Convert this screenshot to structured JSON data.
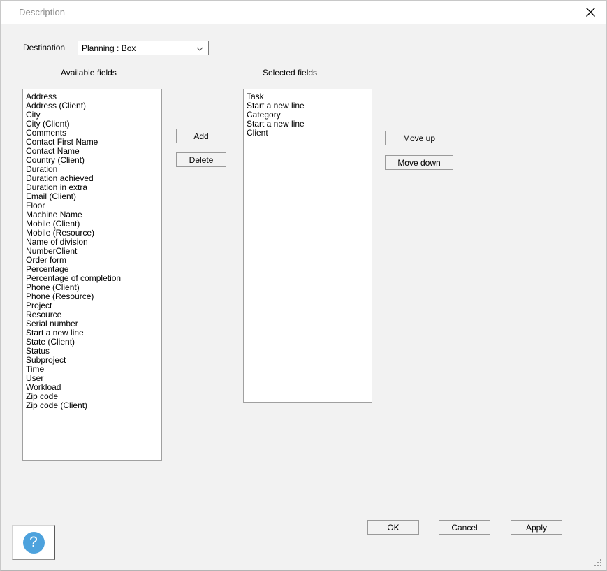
{
  "window": {
    "title": "Description",
    "close_icon": "close-icon"
  },
  "destination": {
    "label": "Destination",
    "value": "Planning : Box",
    "options": [
      "Planning : Box"
    ]
  },
  "available": {
    "heading": "Available fields",
    "items": [
      "Address",
      "Address (Client)",
      "City",
      "City (Client)",
      "Comments",
      "Contact First Name",
      "Contact Name",
      "Country (Client)",
      "Duration",
      "Duration achieved",
      "Duration in extra",
      "Email (Client)",
      "Floor",
      "Machine Name",
      "Mobile (Client)",
      "Mobile (Resource)",
      "Name of division",
      "NumberClient",
      "Order form",
      "Percentage",
      "Percentage of completion",
      "Phone (Client)",
      "Phone (Resource)",
      "Project",
      "Resource",
      "Serial number",
      "Start a new line",
      "State (Client)",
      "Status",
      "Subproject",
      "Time",
      "User",
      "Workload",
      "Zip code",
      "Zip code (Client)"
    ]
  },
  "selected": {
    "heading": "Selected fields",
    "items": [
      "Task",
      "Start a new line",
      "Category",
      "Start a new line",
      "Client"
    ]
  },
  "transfer_buttons": {
    "add": "Add",
    "delete": "Delete"
  },
  "order_buttons": {
    "move_up": "Move up",
    "move_down": "Move down"
  },
  "footer": {
    "help_glyph": "?",
    "ok": "OK",
    "cancel": "Cancel",
    "apply": "Apply"
  },
  "colors": {
    "dialog_background": "#f2f2f2",
    "titlebar_background": "#ffffff",
    "title_text": "#8d8d8d",
    "listbox_background": "#ffffff",
    "listbox_border": "#a0a0a0",
    "button_border": "#9a9a9a",
    "help_accent": "#4da2dd",
    "separator": "#878787"
  }
}
